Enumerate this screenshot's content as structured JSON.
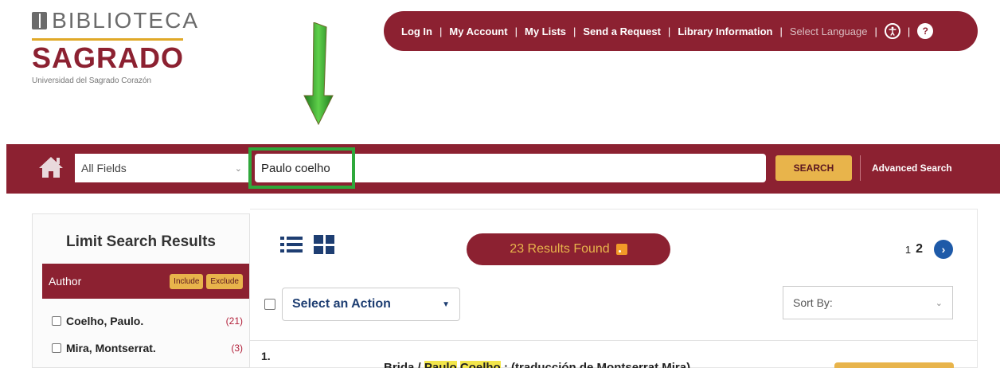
{
  "logo": {
    "top": "BIBLIOTECA",
    "main": "SAGRADO",
    "sub": "Universidad del Sagrado Corazón"
  },
  "topnav": {
    "login": "Log In",
    "account": "My Account",
    "lists": "My Lists",
    "request": "Send a Request",
    "info": "Library Information",
    "language": "Select Language",
    "accessibility_icon": "accessibility-icon",
    "help_icon": "help-icon",
    "help_glyph": "?"
  },
  "search": {
    "field": "All Fields",
    "query": "Paulo coelho",
    "button": "SEARCH",
    "advanced": "Advanced Search"
  },
  "facets": {
    "title": "Limit Search Results",
    "group": "Author",
    "include": "Include",
    "exclude": "Exclude",
    "items": [
      {
        "name": "Coelho, Paulo.",
        "count": "(21)"
      },
      {
        "name": "Mira, Montserrat.",
        "count": "(3)"
      }
    ]
  },
  "results": {
    "found": "23 Results Found",
    "pages": [
      "1",
      "2"
    ],
    "action": "Select an Action",
    "sort": "Sort By:",
    "first_number": "1.",
    "first_title": {
      "prefix": "Brida / ",
      "hl1": "Paulo",
      "hl2": "Coelho",
      "suffix": " ; (traducción de Montserrat Mira)"
    }
  },
  "colors": {
    "brand": "#8c2131",
    "accent": "#e8b44b",
    "highlight_outline": "#2fa83b",
    "link_blue": "#1e3e72"
  }
}
